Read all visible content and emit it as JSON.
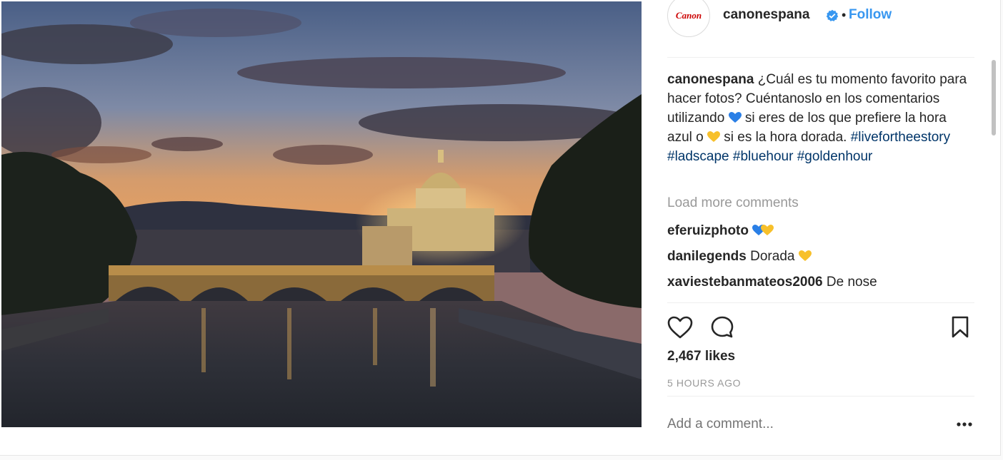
{
  "account": {
    "username": "canonespana",
    "avatar_text": "Canon",
    "separator": "•",
    "follow_label": "Follow",
    "verified_icon": "verified-badge-icon"
  },
  "caption": {
    "username": "canonespana",
    "part1": "¿Cuál es tu momento favorito para hacer fotos? Cuéntanoslo en los comentarios utilizando",
    "part2": "si eres de los que prefiere la hora azul o",
    "part3": "si es la hora dorada.",
    "hashtags": [
      "#livefortheestory",
      "#ladscape",
      "#bluehour",
      "#goldenhour"
    ]
  },
  "load_more": "Load more comments",
  "comments": [
    {
      "username": "eferuizphoto",
      "text": ""
    },
    {
      "username": "danilegends",
      "text": "Dorada"
    },
    {
      "username": "xaviestebanmateos2006",
      "text": "De nose"
    }
  ],
  "likes": "2,467 likes",
  "timestamp": "5 HOURS AGO",
  "add_comment_placeholder": "Add a comment...",
  "colors": {
    "link": "#3897f0",
    "hashtag": "#003569",
    "blue_heart": "#2a7fe6",
    "yellow_heart": "#f7c02b"
  }
}
